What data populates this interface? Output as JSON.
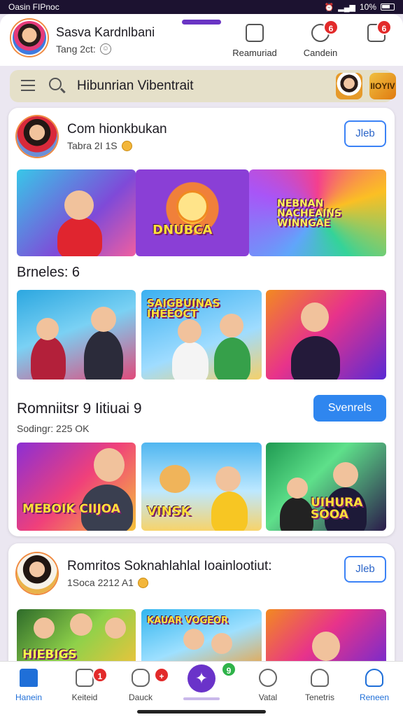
{
  "status": {
    "left": "Oasin FIPnoc",
    "battery": "10%"
  },
  "header": {
    "user_name": "Sasva Kardnlbani",
    "user_sub": "Tang 2ct:",
    "btn_1": "Reamuriad",
    "btn_2": "Candein",
    "badge_1": "6",
    "badge_2": "6"
  },
  "search": {
    "text": "Hibunrian Vibentrait",
    "thumb_logo": "IIOYIV"
  },
  "post1": {
    "title": "Com hionkbukan",
    "sub": "Tabra 2I 1S",
    "follow": "Jleb",
    "banner_captions": [
      "",
      "DNUBCA",
      "NEBNAN NACHEAINS WINNGAE"
    ]
  },
  "section1": {
    "title": "Brneles: 6",
    "captions": [
      "",
      "SAIGBUINAS IHEEOCT",
      ""
    ]
  },
  "section2": {
    "title": "Romniitsr 9 Iitiuai 9",
    "sub": "Sodingr: 225 OK",
    "button": "Svenrels",
    "captions": [
      "MEBOIK CIIJOA",
      "VINSK",
      "UIHURA SOOA"
    ]
  },
  "post2": {
    "title": "Romritos Soknahlahlal Ioainlootiut:",
    "sub": "1Soca 2212 A1",
    "follow": "Jleb",
    "captions": [
      "HIEBIGS",
      "KAUAR VOGEOR",
      ""
    ]
  },
  "nav": {
    "items": [
      "Hanein",
      "Keiteid",
      "Dauck",
      "",
      "Vatal",
      "Tenetris",
      "Reneen"
    ],
    "badges": [
      "1",
      "+",
      "9"
    ]
  }
}
